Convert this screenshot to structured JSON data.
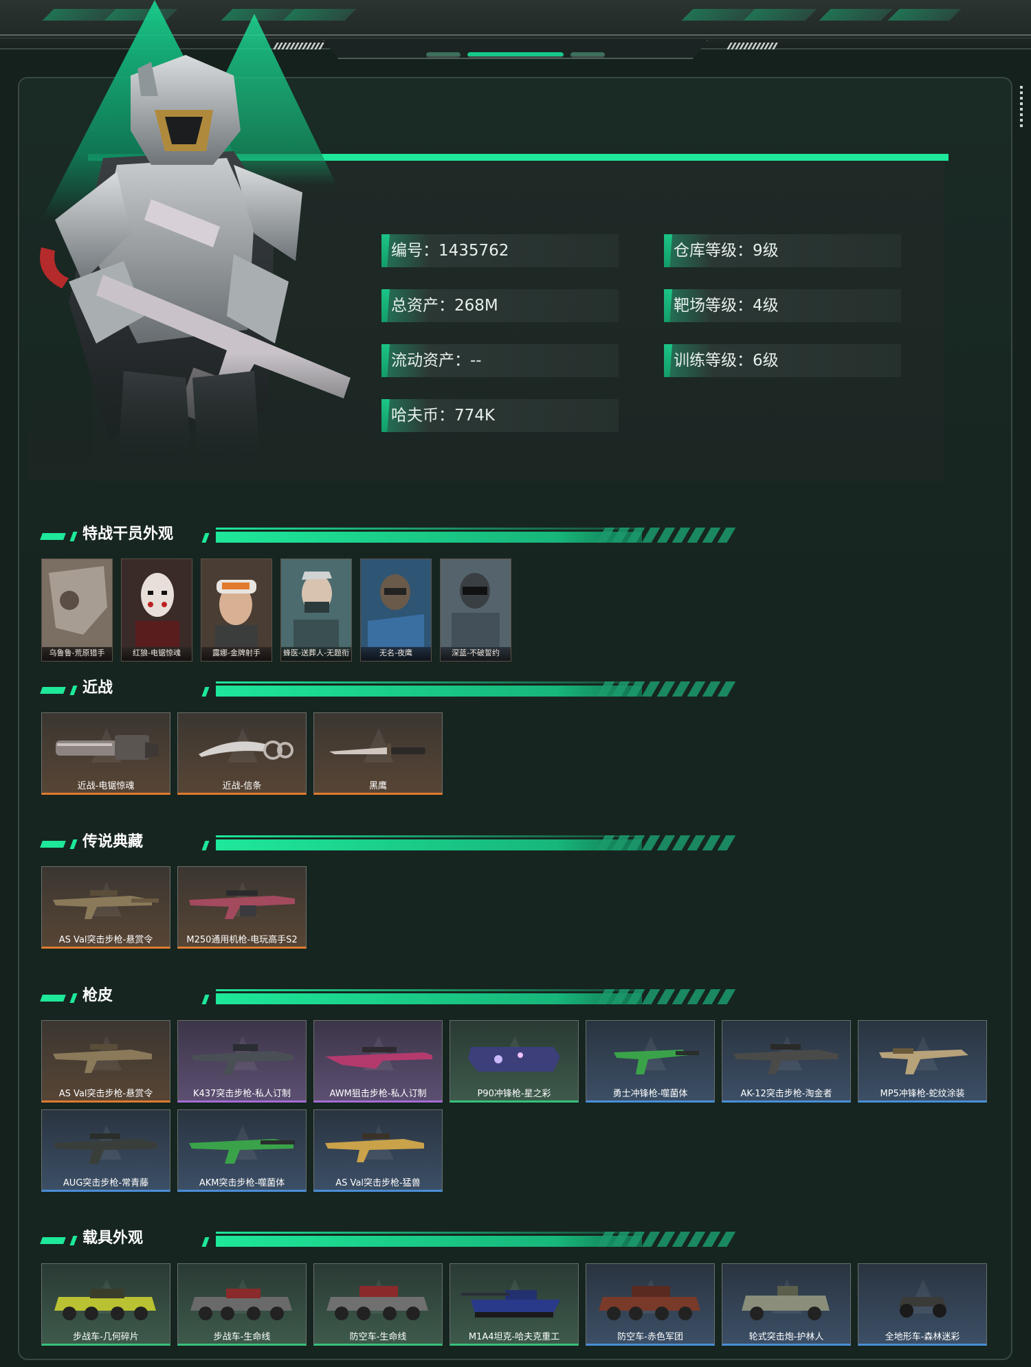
{
  "profile": {
    "stats_left": [
      {
        "label": "编号",
        "value": "1435762"
      },
      {
        "label": "总资产",
        "value": "268M"
      },
      {
        "label": "流动资产",
        "value": "--"
      },
      {
        "label": "哈夫币",
        "value": "774K"
      }
    ],
    "stats_right": [
      {
        "label": "仓库等级",
        "value": "9级"
      },
      {
        "label": "靶场等级",
        "value": "4级"
      },
      {
        "label": "训练等级",
        "value": "6级"
      }
    ]
  },
  "sections": {
    "operators": {
      "title": "特战干员外观",
      "items": [
        {
          "name": "乌鲁鲁-荒原猎手"
        },
        {
          "name": "红狼-电锯惊魂"
        },
        {
          "name": "露娜-金牌射手"
        },
        {
          "name": "蜂医-送葬人-无题衔"
        },
        {
          "name": "无名-夜鹰"
        },
        {
          "name": "深蓝-不破誓约"
        }
      ]
    },
    "melee": {
      "title": "近战",
      "items": [
        {
          "name": "近战-电锯惊魂",
          "rarity": "orange"
        },
        {
          "name": "近战-信条",
          "rarity": "orange"
        },
        {
          "name": "黑鹰",
          "rarity": "orange"
        }
      ]
    },
    "legendary": {
      "title": "传说典藏",
      "items": [
        {
          "name": "AS Val突击步枪-悬赏令",
          "rarity": "orange"
        },
        {
          "name": "M250通用机枪-电玩高手S2",
          "rarity": "orange"
        }
      ]
    },
    "skins": {
      "title": "枪皮",
      "items": [
        {
          "name": "AS Val突击步枪-悬赏令",
          "rarity": "orange"
        },
        {
          "name": "K437突击步枪-私人订制",
          "rarity": "purple"
        },
        {
          "name": "AWM狙击步枪-私人订制",
          "rarity": "purple"
        },
        {
          "name": "P90冲锋枪-星之彩",
          "rarity": "green"
        },
        {
          "name": "勇士冲锋枪-噬菌体",
          "rarity": "blue"
        },
        {
          "name": "AK-12突击步枪-淘金者",
          "rarity": "blue"
        },
        {
          "name": "MP5冲锋枪-蛇纹涂装",
          "rarity": "blue"
        },
        {
          "name": "AUG突击步枪-常青藤",
          "rarity": "blue"
        },
        {
          "name": "AKM突击步枪-噬菌体",
          "rarity": "blue"
        },
        {
          "name": "AS Val突击步枪-猛兽",
          "rarity": "blue"
        }
      ]
    },
    "vehicles": {
      "title": "载具外观",
      "items": [
        {
          "name": "步战车-几何碎片",
          "rarity": "green"
        },
        {
          "name": "步战车-生命线",
          "rarity": "green"
        },
        {
          "name": "防空车-生命线",
          "rarity": "green"
        },
        {
          "name": "M1A4坦克-哈夫克重工",
          "rarity": "green"
        },
        {
          "name": "防空车-赤色军团",
          "rarity": "blue"
        },
        {
          "name": "轮式突击炮-护林人",
          "rarity": "blue"
        },
        {
          "name": "全地形车-森林迷彩",
          "rarity": "blue"
        }
      ]
    }
  },
  "colors": {
    "accent": "#1ee89a",
    "background": "#162520",
    "rarity_orange": "#e07b2f",
    "rarity_purple": "#a66dd6",
    "rarity_green": "#37c27c",
    "rarity_blue": "#4a8fd8"
  }
}
